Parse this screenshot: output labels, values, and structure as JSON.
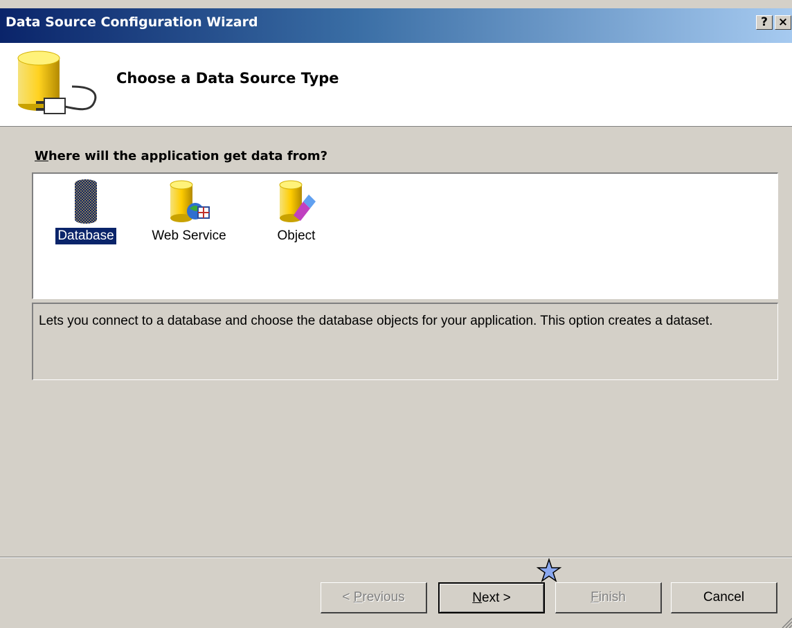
{
  "window": {
    "title": "Data Source Configuration Wizard",
    "help_label": "?",
    "close_label": "×"
  },
  "header": {
    "title": "Choose a Data Source Type"
  },
  "main": {
    "question_mnemonic": "W",
    "question_rest": "here will the application get data from?",
    "items": [
      {
        "label": "Database",
        "icon": "database-icon",
        "selected": true
      },
      {
        "label": "Web Service",
        "icon": "web-service-icon",
        "selected": false
      },
      {
        "label": "Object",
        "icon": "object-icon",
        "selected": false
      }
    ],
    "description": "Lets you connect to a database and choose the database objects for your application. This option creates a dataset."
  },
  "buttons": {
    "previous_pre": "< ",
    "previous_mnemonic": "P",
    "previous_rest": "revious",
    "next_mnemonic": "N",
    "next_rest": "ext >",
    "finish_mnemonic": "F",
    "finish_rest": "inish",
    "cancel": "Cancel"
  },
  "colors": {
    "title_active": "#0a246a",
    "selection": "#0a246a",
    "face": "#d4d0c8"
  }
}
